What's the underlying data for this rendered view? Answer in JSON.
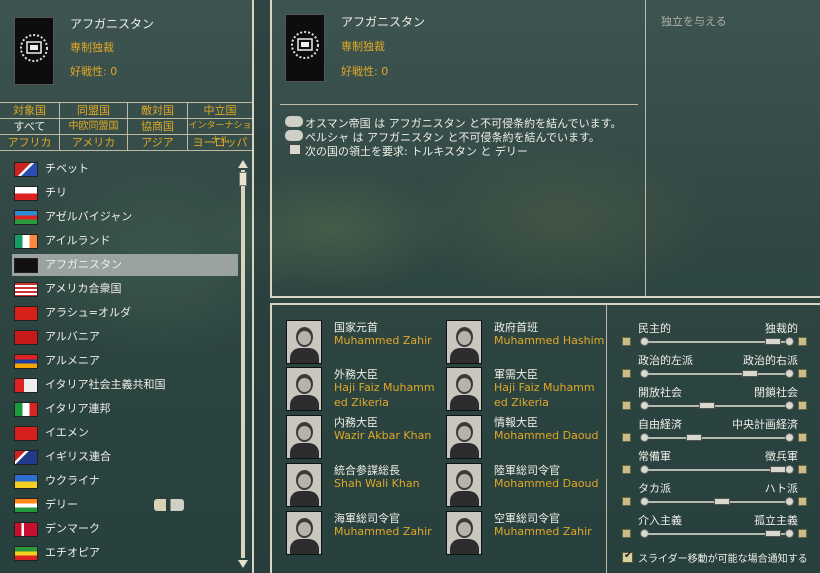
{
  "country": {
    "name": "アフガニスタン",
    "government": "専制独裁",
    "belligerence": "好戦性: 0"
  },
  "independence_button": "独立を与える",
  "filter_tabs": [
    [
      "対象国",
      "同盟国",
      "敵対国",
      "中立国"
    ],
    [
      "すべて",
      "中欧同盟国",
      "協商国",
      "インターナショナル"
    ],
    [
      "アフリカ",
      "アメリカ",
      "アジア",
      "ヨーロッパ"
    ]
  ],
  "country_list": [
    {
      "name": "チベット",
      "flag": "tibet"
    },
    {
      "name": "チリ",
      "flag": "chile"
    },
    {
      "name": "アゼルバイジャン",
      "flag": "azerbaijan"
    },
    {
      "name": "アイルランド",
      "flag": "ireland"
    },
    {
      "name": "アフガニスタン",
      "flag": "afghanistan",
      "selected": true
    },
    {
      "name": "アメリカ合衆国",
      "flag": "usa"
    },
    {
      "name": "アラシュ=オルダ",
      "flag": "alash"
    },
    {
      "name": "アルバニア",
      "flag": "albania"
    },
    {
      "name": "アルメニア",
      "flag": "armenia"
    },
    {
      "name": "イタリア社会主義共和国",
      "flag": "italy-socialist"
    },
    {
      "name": "イタリア連邦",
      "flag": "italy"
    },
    {
      "name": "イエメン",
      "flag": "yemen"
    },
    {
      "name": "イギリス連合",
      "flag": "uk"
    },
    {
      "name": "ウクライナ",
      "flag": "ukraine"
    },
    {
      "name": "デリー",
      "flag": "delhi",
      "has_icons": true
    },
    {
      "name": "デンマーク",
      "flag": "denmark"
    },
    {
      "name": "エチオピア",
      "flag": "ethiopia"
    }
  ],
  "relations": [
    {
      "icon": "handshake-icon",
      "text": "オスマン帝国 は アフガニスタン と不可侵条約を結んでいます。"
    },
    {
      "icon": "handshake-icon",
      "text": "ペルシャ は アフガニスタン と不可侵条約を結んでいます。"
    },
    {
      "icon": "claim-icon",
      "text": "次の国の領土を要求: トルキスタン と デリー"
    }
  ],
  "ministers": [
    {
      "title": "国家元首",
      "name": "Muhammed Zahir"
    },
    {
      "title": "政府首班",
      "name": "Muhammed Hashim"
    },
    {
      "title": "外務大臣",
      "name": "Haji Faiz Muhamm ed Zikeria"
    },
    {
      "title": "軍需大臣",
      "name": "Haji Faiz Muhamm ed Zikeria"
    },
    {
      "title": "内務大臣",
      "name": "Wazir Akbar Khan"
    },
    {
      "title": "情報大臣",
      "name": "Mohammed Daoud"
    },
    {
      "title": "統合参謀総長",
      "name": "Shah Wali Khan"
    },
    {
      "title": "陸軍総司令官",
      "name": "Mohammed Daoud"
    },
    {
      "title": "海軍総司令官",
      "name": "Muhammed Zahir"
    },
    {
      "title": "空軍総司令官",
      "name": "Muhammed Zahir"
    }
  ],
  "sliders": [
    {
      "left": "民主的",
      "right": "独裁的",
      "value": 0.89
    },
    {
      "left": "政治的左派",
      "right": "政治的右派",
      "value": 0.73
    },
    {
      "left": "開放社会",
      "right": "閉鎖社会",
      "value": 0.42
    },
    {
      "left": "自由経済",
      "right": "中央計画経済",
      "value": 0.33
    },
    {
      "left": "常備軍",
      "right": "徴兵軍",
      "value": 0.93
    },
    {
      "left": "タカ派",
      "right": "ハト派",
      "value": 0.53
    },
    {
      "left": "介入主義",
      "right": "孤立主義",
      "value": 0.89
    }
  ],
  "notify_checkbox": {
    "label": "スライダー移動が可能な場合通知する",
    "checked": true
  },
  "colors": {
    "accent_gold": "#e0a826",
    "selected_row": "#9aa39f"
  }
}
